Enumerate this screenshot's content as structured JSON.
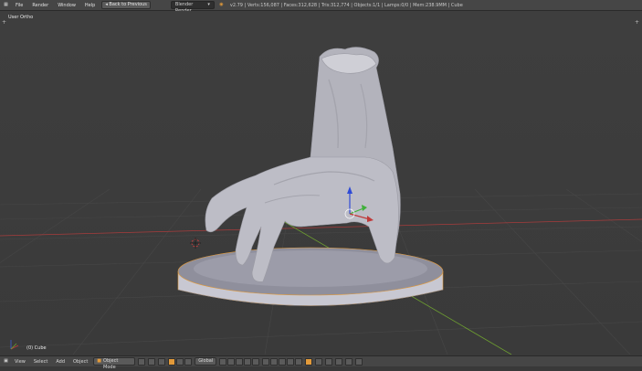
{
  "menu": [
    "File",
    "Render",
    "Window",
    "Help"
  ],
  "back_button": "Back to Previous",
  "render_engine": "Blender Render",
  "stats": "v2.79 | Verts:156,087 | Faces:312,628 | Tris:312,774 | Objects:1/1 | Lamps:0/0 | Mem:238.9MM | Cube",
  "viewport": {
    "view_label": "User Ortho",
    "object_label": "(0) Cube"
  },
  "bottom": {
    "menu": [
      "View",
      "Select",
      "Add",
      "Object"
    ],
    "mode": "Object Mode",
    "orientation": "Global"
  },
  "icons": {
    "info": "info-icon",
    "blender": "blender-logo-icon",
    "cursor": "3d-cursor-icon"
  },
  "colors": {
    "viewport_bg": "#3b3b3b",
    "grid": "#474747",
    "axis_x": "#a83c3c",
    "axis_y": "#6ea030",
    "accent": "#e29a3a",
    "gizmo_z": "#2f4bd6"
  }
}
